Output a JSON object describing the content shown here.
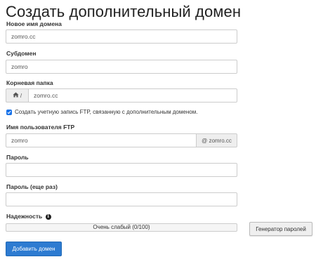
{
  "page": {
    "title": "Создать дополнительный домен"
  },
  "form": {
    "new_domain": {
      "label": "Новое имя домена",
      "value": "zomro.cc"
    },
    "subdomain": {
      "label": "Субдомен",
      "value": "zomro"
    },
    "root_folder": {
      "label": "Корневая папка",
      "prefix": "/",
      "value": "zomro.cc"
    },
    "ftp_checkbox": {
      "label": "Создать учетную запись FTP, связанную с дополнительным доменом.",
      "checked": true
    },
    "ftp_username": {
      "label": "Имя пользователя FTP",
      "value": "zomro",
      "suffix": "@ zomro.cc"
    },
    "password": {
      "label": "Пароль",
      "value": ""
    },
    "password_repeat": {
      "label": "Пароль (еще раз)",
      "value": ""
    },
    "strength": {
      "label": "Надежность",
      "text": "Очень слабый (0/100)",
      "value": 0
    },
    "generator_button": "Генератор паролей",
    "submit_button": "Добавить домен"
  },
  "colors": {
    "accent": "#2d7bd1",
    "checkbox": "#1a73e8"
  }
}
